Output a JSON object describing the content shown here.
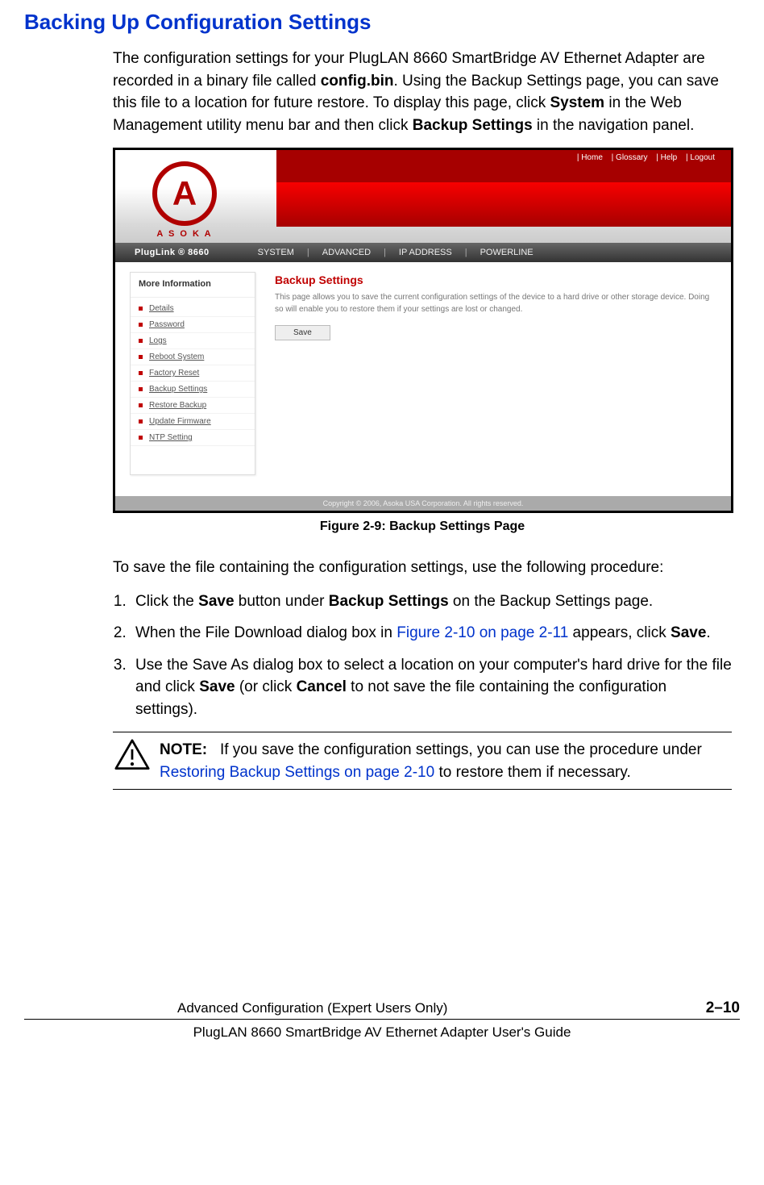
{
  "heading": "Backing Up Configuration Settings",
  "intro": {
    "part1": "The configuration settings for your PlugLAN 8660 SmartBridge AV Ethernet Adapter are recorded in a binary file called ",
    "bold1": "config.bin",
    "part2": ". Using the Backup Settings page, you can save this file to a location for future restore. To display this page, click ",
    "bold2": "System",
    "part3": " in the Web Management utility menu bar and then click ",
    "bold3": "Backup Settings",
    "part4": " in the navigation panel."
  },
  "figure": {
    "logo_text": "A S O K A",
    "top_links": [
      "| Home",
      "| Glossary",
      "| Help",
      "| Logout"
    ],
    "menu_title": "PlugLink ®   8660",
    "menu_items": [
      "SYSTEM",
      "ADVANCED",
      "IP ADDRESS",
      "POWERLINE"
    ],
    "sidebar_title": "More Information",
    "sidebar_items": [
      "Details",
      "Password",
      "Logs",
      "Reboot System",
      "Factory Reset",
      "Backup Settings",
      "Restore Backup",
      "Update Firmware",
      "NTP Setting"
    ],
    "content_heading": "Backup Settings",
    "content_desc": "This page allows you to save the current configuration settings of the device to a hard drive or other storage device. Doing so will enable you to restore them if your settings are lost or changed.",
    "save_label": "Save",
    "copyright": "Copyright © 2006, Asoka USA Corporation. All rights reserved."
  },
  "caption": "Figure 2-9:  Backup Settings Page",
  "procedure_intro": "To save the file containing the configuration settings, use the following procedure:",
  "steps": {
    "s1_a": "Click the ",
    "s1_b1": "Save",
    "s1_b": " button under ",
    "s1_b2": "Backup Settings",
    "s1_c": " on the Backup Settings page.",
    "s2_a": "When the File Download dialog box in ",
    "s2_link": "Figure 2-10 on page 2-11",
    "s2_b": " appears, click ",
    "s2_bold": "Save",
    "s2_c": ".",
    "s3_a": "Use the Save As dialog box to select a location on your computer's hard drive for the file and click ",
    "s3_b1": "Save",
    "s3_b": " (or click ",
    "s3_b2": "Cancel",
    "s3_c": " to not save the file containing the configuration settings)."
  },
  "note": {
    "label": "NOTE:",
    "part1": "If you save the configuration settings, you can use the procedure under ",
    "link": "Restoring Backup Settings on page 2-10",
    "part2": " to restore them if necessary."
  },
  "footer": {
    "section": "Advanced Configuration (Expert Users Only)",
    "page_num": "2–10",
    "guide": "PlugLAN 8660 SmartBridge AV Ethernet Adapter User's Guide"
  }
}
